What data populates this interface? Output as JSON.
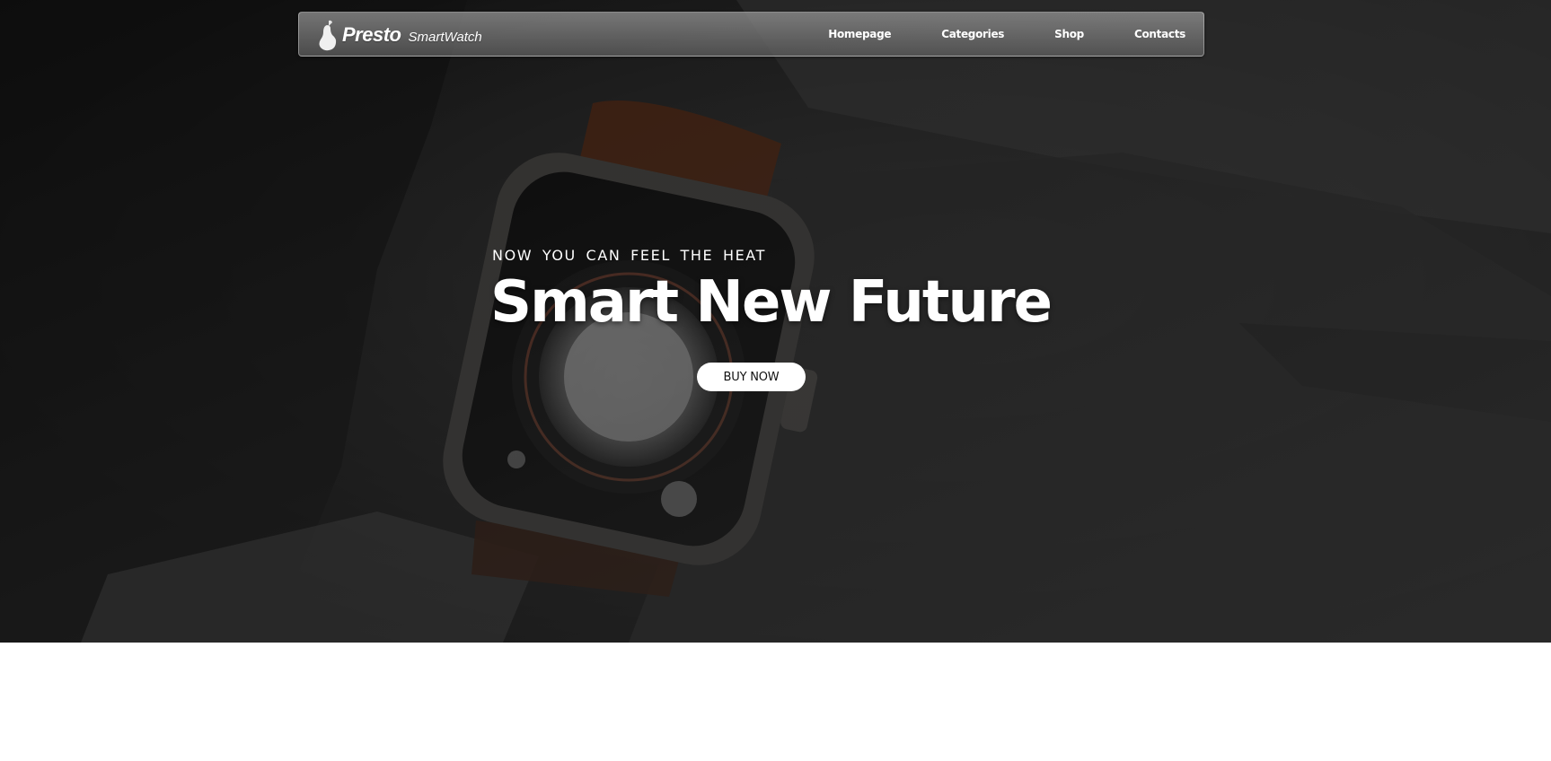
{
  "brand": {
    "name": "Presto",
    "subtitle": "SmartWatch",
    "icon": "pear-icon"
  },
  "nav": {
    "items": [
      {
        "label": "Homepage"
      },
      {
        "label": "Categories"
      },
      {
        "label": "Shop"
      },
      {
        "label": "Contacts"
      }
    ]
  },
  "hero": {
    "tagline": "NOW YOU CAN FEEL THE HEAT",
    "headline": "Smart New Future",
    "cta_label": "BUY NOW",
    "background_image": "smartwatch-on-wrist-photo"
  },
  "colors": {
    "overlay": "#1e1e1e",
    "nav_text": "#ffffff",
    "button_bg": "#ffffff",
    "button_text": "#111111",
    "strap": "#7a3a1c"
  }
}
